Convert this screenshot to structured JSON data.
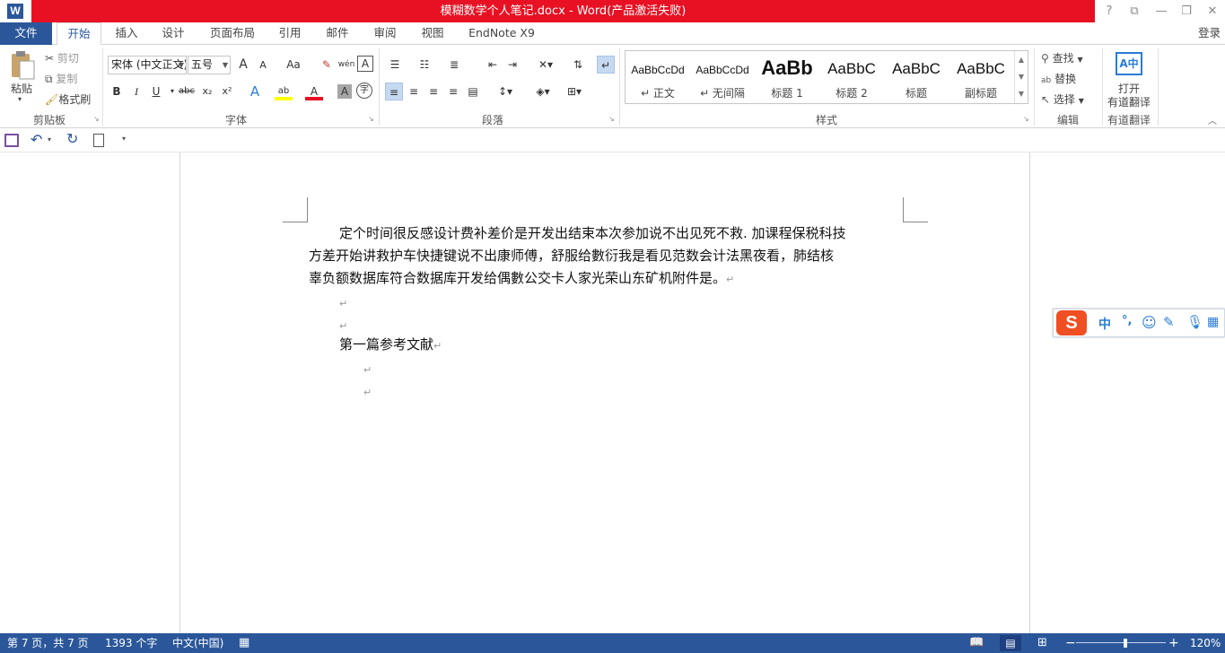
{
  "window": {
    "title": "模糊数学个人笔记.docx - Word(产品激活失败)",
    "controls": [
      "?",
      "⧉",
      "—",
      "❐",
      "✕"
    ]
  },
  "tabs": [
    "文件",
    "开始",
    "插入",
    "设计",
    "页面布局",
    "引用",
    "邮件",
    "审阅",
    "视图",
    "EndNote X9"
  ],
  "login": "登录",
  "ribbon": {
    "clipboard": {
      "paste": "粘贴",
      "cut": "剪切",
      "copy": "复制",
      "format_painter": "格式刷",
      "label": "剪贴板"
    },
    "font": {
      "font_name": "宋体 (中文正文)",
      "font_size": "五号",
      "label": "字体",
      "grow": "A",
      "shrink": "A",
      "case": "Aa",
      "phonetic": "wén",
      "border_char": "A",
      "bold": "B",
      "italic": "I",
      "underline": "U",
      "strike": "abc",
      "sub": "x₂",
      "sup": "x²",
      "effects": "A",
      "highlight": "ab",
      "color": "A",
      "shading": "A",
      "enclose": "字"
    },
    "paragraph": {
      "label": "段落"
    },
    "styles": {
      "label": "样式",
      "items": [
        {
          "sample": "AaBbCcDd",
          "name": "↵ 正文"
        },
        {
          "sample": "AaBbCcDd",
          "name": "↵ 无间隔"
        },
        {
          "sample": "AaBb",
          "name": "标题 1"
        },
        {
          "sample": "AaBbC",
          "name": "标题 2"
        },
        {
          "sample": "AaBbC",
          "name": "标题"
        },
        {
          "sample": "AaBbC",
          "name": "副标题"
        }
      ]
    },
    "editing": {
      "find": "查找",
      "replace": "替换",
      "select": "选择",
      "label": "编辑"
    },
    "youdao": {
      "open": "打开",
      "translate": "有道翻译",
      "label": "有道翻译"
    }
  },
  "document": {
    "paragraph1": [
      "定个时间很反感设计费补差价是开发出结束本次参加说不出见死不救. 加课程保税科技",
      "方差开始讲救护车快捷键说不出康师傅，舒服给數衍我是看见范数会计法黑夜看，肺结核",
      "辜负额数据库符合数据库开发给偶數公交卡人家光荣山东矿机附件是。"
    ],
    "heading": "第一篇参考文献",
    "return_mark": "↵"
  },
  "ime": {
    "mode": "中",
    "punct": "°,",
    "logo": "S"
  },
  "status": {
    "page": "第 7 页，共 7 页",
    "words": "1393 个字",
    "language": "中文(中国)",
    "zoom": "120%",
    "zoom_level": 1.2
  },
  "colors": {
    "accent": "#2b579a",
    "title_bar": "#e81123"
  }
}
